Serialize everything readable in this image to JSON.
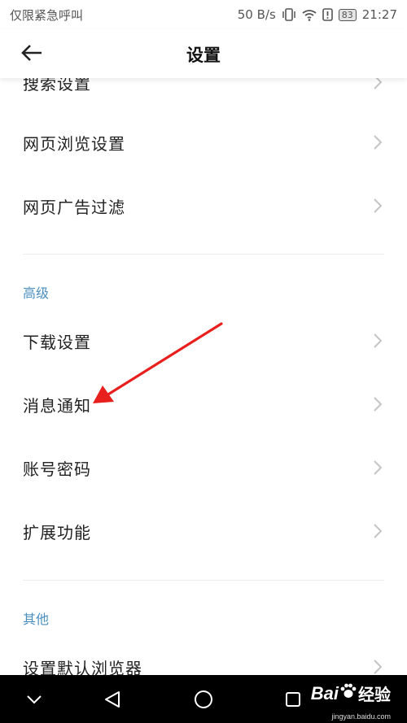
{
  "status_bar": {
    "carrier": "仅限紧急呼叫",
    "speed": "50 B/s",
    "battery": "83",
    "time": "21:27",
    "icons": [
      "vibrate-icon",
      "wifi-icon",
      "alert-icon",
      "battery-icon"
    ]
  },
  "header": {
    "title": "设置",
    "back_icon": "back-arrow-icon"
  },
  "settings": {
    "top_rows": [
      {
        "label": "搜索设置"
      },
      {
        "label": "网页浏览设置"
      },
      {
        "label": "网页广告过滤"
      }
    ],
    "advanced_header": "高级",
    "advanced_rows": [
      {
        "label": "下载设置"
      },
      {
        "label": "消息通知"
      },
      {
        "label": "账号密码"
      },
      {
        "label": "扩展功能"
      }
    ],
    "other_header": "其他",
    "other_rows": [
      {
        "label": "设置默认浏览器"
      }
    ]
  },
  "annotation": {
    "arrow_color": "#e8201d",
    "points_to": "消息通知"
  },
  "nav_bar": {
    "icons": [
      "chevron-down-icon",
      "back-triangle-icon",
      "home-circle-icon",
      "recents-square-icon"
    ]
  },
  "watermark": {
    "brand_bai": "Bai",
    "brand_jingyan": "经验",
    "url": "jingyan.baidu.com"
  },
  "colors": {
    "section_header": "#4a8fc0",
    "nav_bar": "#000000"
  }
}
